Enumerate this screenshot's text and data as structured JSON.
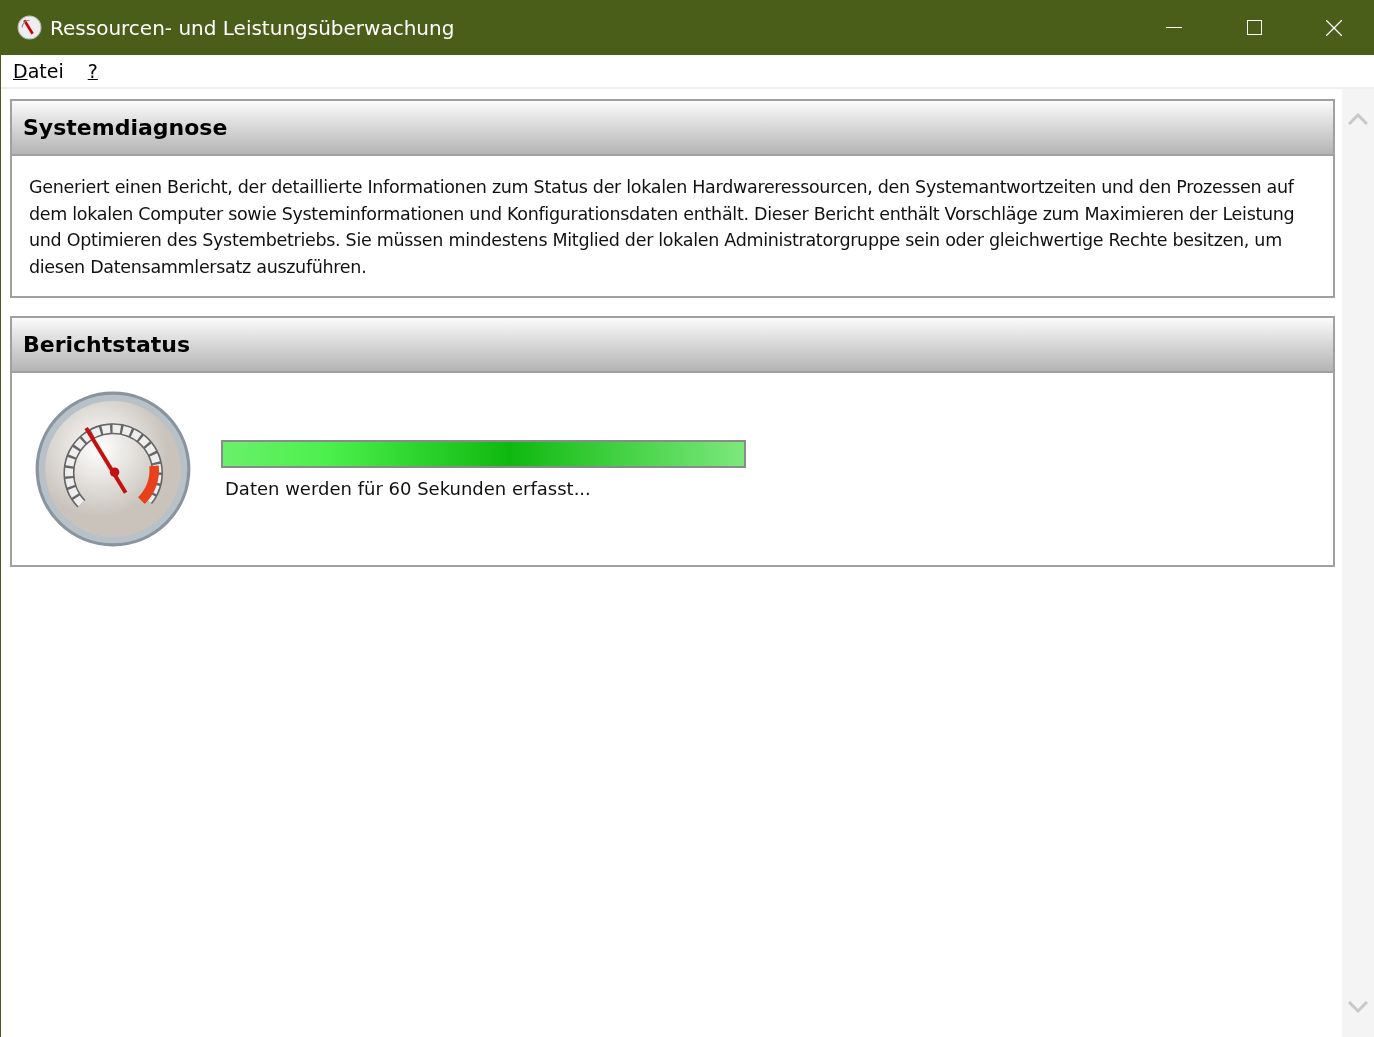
{
  "window": {
    "title": "Ressourcen- und Leistungsüberwachung"
  },
  "menu": [
    {
      "label": "Datei"
    },
    {
      "label": "?"
    }
  ],
  "sections": [
    {
      "kind": "text",
      "title": "Systemdiagnose",
      "text": "Generiert einen Bericht, der detaillierte Informationen zum Status der lokalen Hardwareressourcen, den Systemantwortzeiten und den Prozessen auf dem lokalen Computer sowie Systeminformationen und Konfigurationsdaten enthält. Dieser Bericht enthält Vorschläge zum Maximieren der Leistung und Optimieren des Systembetriebs. Sie müssen mindestens Mitglied der lokalen Administratorgruppe sein oder gleichwertige Rechte besitzen, um diesen Datensammlersatz auszuführen."
    },
    {
      "kind": "progress",
      "title": "Berichtstatus",
      "level": 1,
      "text": "Daten werden für 60 Sekunden erfasst..."
    }
  ]
}
